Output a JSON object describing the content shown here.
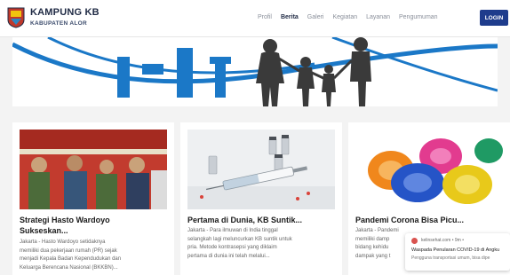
{
  "header": {
    "brand_title": "KAMPUNG KB",
    "brand_subtitle": "KABUPATEN ALOR",
    "nav": [
      "Profil",
      "Berita",
      "Galeri",
      "Kegiatan",
      "Layanan",
      "Pengumuman"
    ],
    "active_nav": "Berita",
    "login_label": "LOGIN"
  },
  "cards": [
    {
      "title_line1": "Strategi Hasto Wardoyo",
      "title_line2": "Sukseskan...",
      "excerpt_lines": [
        "Jakarta - Hasto Wardoyo setidaknya",
        "memiliki dua pekerjaan rumah (PR) sejak",
        "menjadi Kepala Badan Kependudukan dan",
        "Keluarga Berencana Nasional (BKKBN)..."
      ]
    },
    {
      "title_line1": "Pertama di Dunia, KB Suntik...",
      "title_line2": "",
      "excerpt_lines": [
        "Jakarta - Para ilmuwan di India tinggal",
        "selangkah lagi meluncurkan KB suntik untuk",
        "pria. Metode kontrasepsi yang diklaim",
        "pertama di dunia ini telah melalui..."
      ]
    },
    {
      "title_line1": "Pandemi Corona Bisa Picu...",
      "title_line2": "",
      "excerpt_lines": [
        "Jakarta - Pandemi",
        "memiliki damp",
        "bidang kehidu",
        "dampak yang t"
      ]
    }
  ],
  "notification": {
    "source": "kelinsehat.com • 9m •",
    "headline": "Waspada Penularan COVID-19 di Angku",
    "body": "Pengguna transportasi umum, bisa dipe"
  },
  "colors": {
    "brand_navy": "#1f2a44",
    "login_bg": "#1e3c8c",
    "hero_blue": "#1b78c7"
  }
}
